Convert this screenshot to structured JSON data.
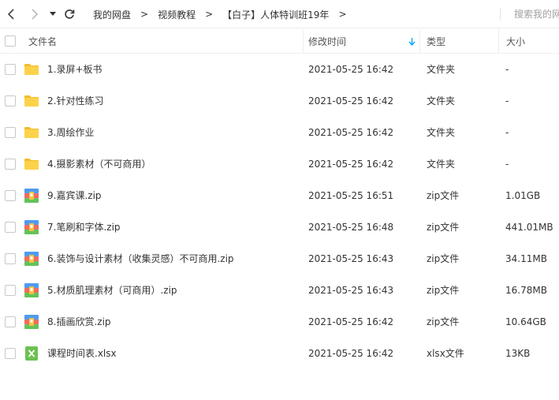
{
  "toolbar": {
    "breadcrumbs": [
      "我的网盘",
      "视频教程",
      "【白子】人体特训班19年"
    ],
    "separator": ">",
    "search_placeholder": "搜索我的网盘文件"
  },
  "header": {
    "name": "文件名",
    "date": "修改时间",
    "type": "类型",
    "size": "大小"
  },
  "files": [
    {
      "name": "1.录屏+板书",
      "date": "2021-05-25 16:42",
      "type": "文件夹",
      "size": "-",
      "icon": "folder-icon"
    },
    {
      "name": "2.针对性练习",
      "date": "2021-05-25 16:42",
      "type": "文件夹",
      "size": "-",
      "icon": "folder-icon"
    },
    {
      "name": "3.周绘作业",
      "date": "2021-05-25 16:42",
      "type": "文件夹",
      "size": "-",
      "icon": "folder-icon"
    },
    {
      "name": "4.摄影素材（不可商用）",
      "date": "2021-05-25 16:42",
      "type": "文件夹",
      "size": "-",
      "icon": "folder-icon"
    },
    {
      "name": "9.嘉宾课.zip",
      "date": "2021-05-25 16:51",
      "type": "zip文件",
      "size": "1.01GB",
      "icon": "zip-archive-icon"
    },
    {
      "name": "7.笔刷和字体.zip",
      "date": "2021-05-25 16:48",
      "type": "zip文件",
      "size": "441.01MB",
      "icon": "zip-archive-icon"
    },
    {
      "name": "6.装饰与设计素材（收集灵感）不可商用.zip",
      "date": "2021-05-25 16:43",
      "type": "zip文件",
      "size": "34.11MB",
      "icon": "zip-archive-icon"
    },
    {
      "name": "5.材质肌理素材（可商用）.zip",
      "date": "2021-05-25 16:43",
      "type": "zip文件",
      "size": "16.78MB",
      "icon": "zip-archive-icon"
    },
    {
      "name": "8.插画欣赏.zip",
      "date": "2021-05-25 16:42",
      "type": "zip文件",
      "size": "10.64GB",
      "icon": "zip-archive-icon"
    },
    {
      "name": "课程时间表.xlsx",
      "date": "2021-05-25 16:42",
      "type": "xlsx文件",
      "size": "13KB",
      "icon": "excel-file-icon"
    }
  ],
  "colors": {
    "folder": "#fcd24a",
    "folder_dark": "#f4bc2a",
    "accent": "#06a7ff",
    "excel": "#6cc152"
  }
}
